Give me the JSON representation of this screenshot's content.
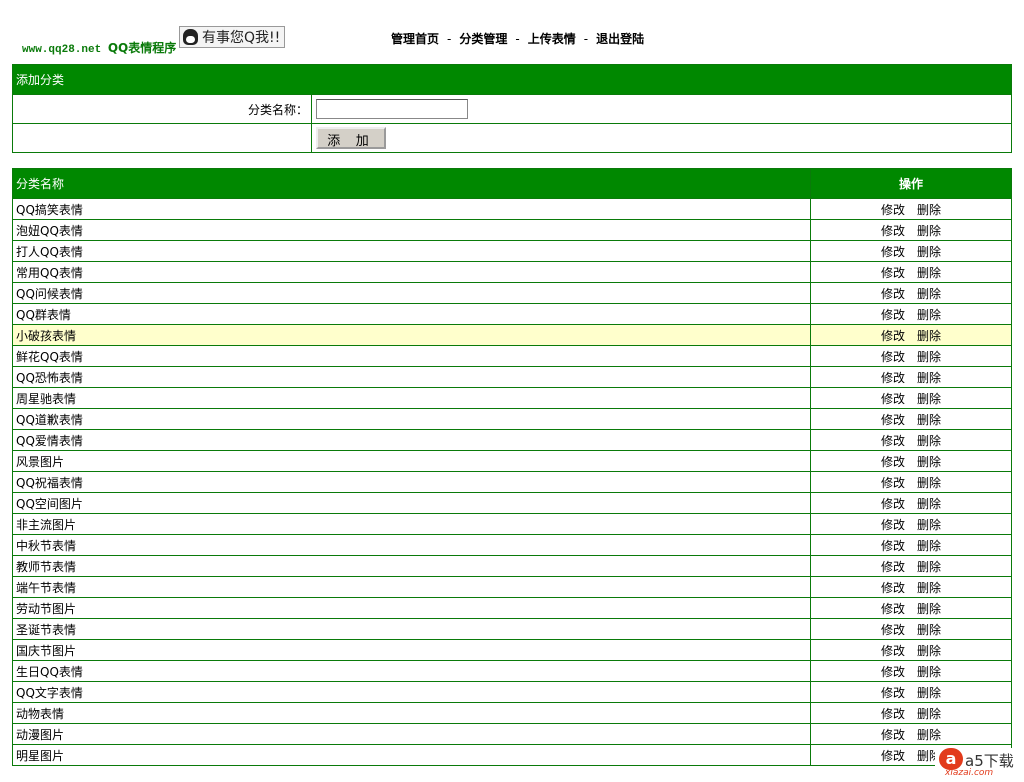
{
  "header": {
    "site": "www.qq28.net",
    "app": "QQ表情程序",
    "qq_badge": "有事您Q我!!",
    "nav": [
      "管理首页",
      "分类管理",
      "上传表情",
      "退出登陆"
    ],
    "nav_sep": "-"
  },
  "add_form": {
    "title": "添加分类",
    "name_label": "分类名称：",
    "name_value": "",
    "submit": "添 加"
  },
  "list": {
    "col_name": "分类名称",
    "col_ops": "操作",
    "edit": "修改",
    "delete": "删除",
    "rows": [
      "QQ搞笑表情",
      "泡妞QQ表情",
      "打人QQ表情",
      "常用QQ表情",
      "QQ问候表情",
      "QQ群表情",
      "小破孩表情",
      "鲜花QQ表情",
      "QQ恐怖表情",
      "周星驰表情",
      "QQ道歉表情",
      "QQ爱情表情",
      "风景图片",
      "QQ祝福表情",
      "QQ空间图片",
      "非主流图片",
      "中秋节表情",
      "教师节表情",
      "端午节表情",
      "劳动节图片",
      "圣诞节表情",
      "国庆节图片",
      "生日QQ表情",
      "QQ文字表情",
      "动物表情",
      "动漫图片",
      "明星图片"
    ],
    "highlighted_index": 6
  },
  "watermark": {
    "brand": "a5下载",
    "domain": "xiazai.com"
  }
}
